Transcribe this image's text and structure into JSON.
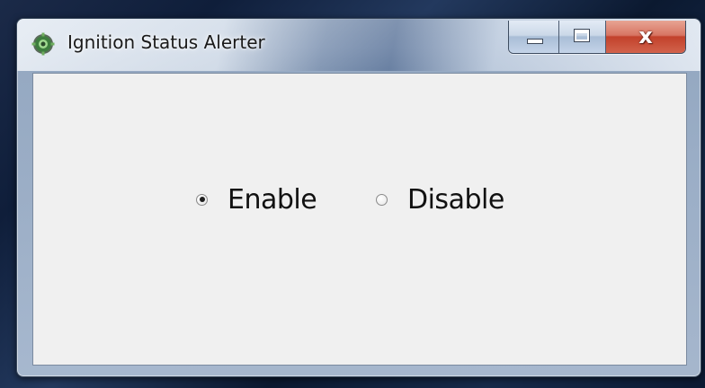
{
  "window": {
    "title": "Ignition Status Alerter",
    "icon": "gear-app-icon",
    "caption_buttons": {
      "minimize_icon": "minimize-icon",
      "maximize_icon": "maximize-icon",
      "close_icon": "close-icon",
      "close_glyph": "x"
    }
  },
  "radio_group": {
    "options": [
      {
        "label": "Enable",
        "checked": true
      },
      {
        "label": "Disable",
        "checked": false
      }
    ]
  },
  "colors": {
    "client_background": "#f0f0f0",
    "close_button": "#c2412b",
    "text": "#111111"
  }
}
